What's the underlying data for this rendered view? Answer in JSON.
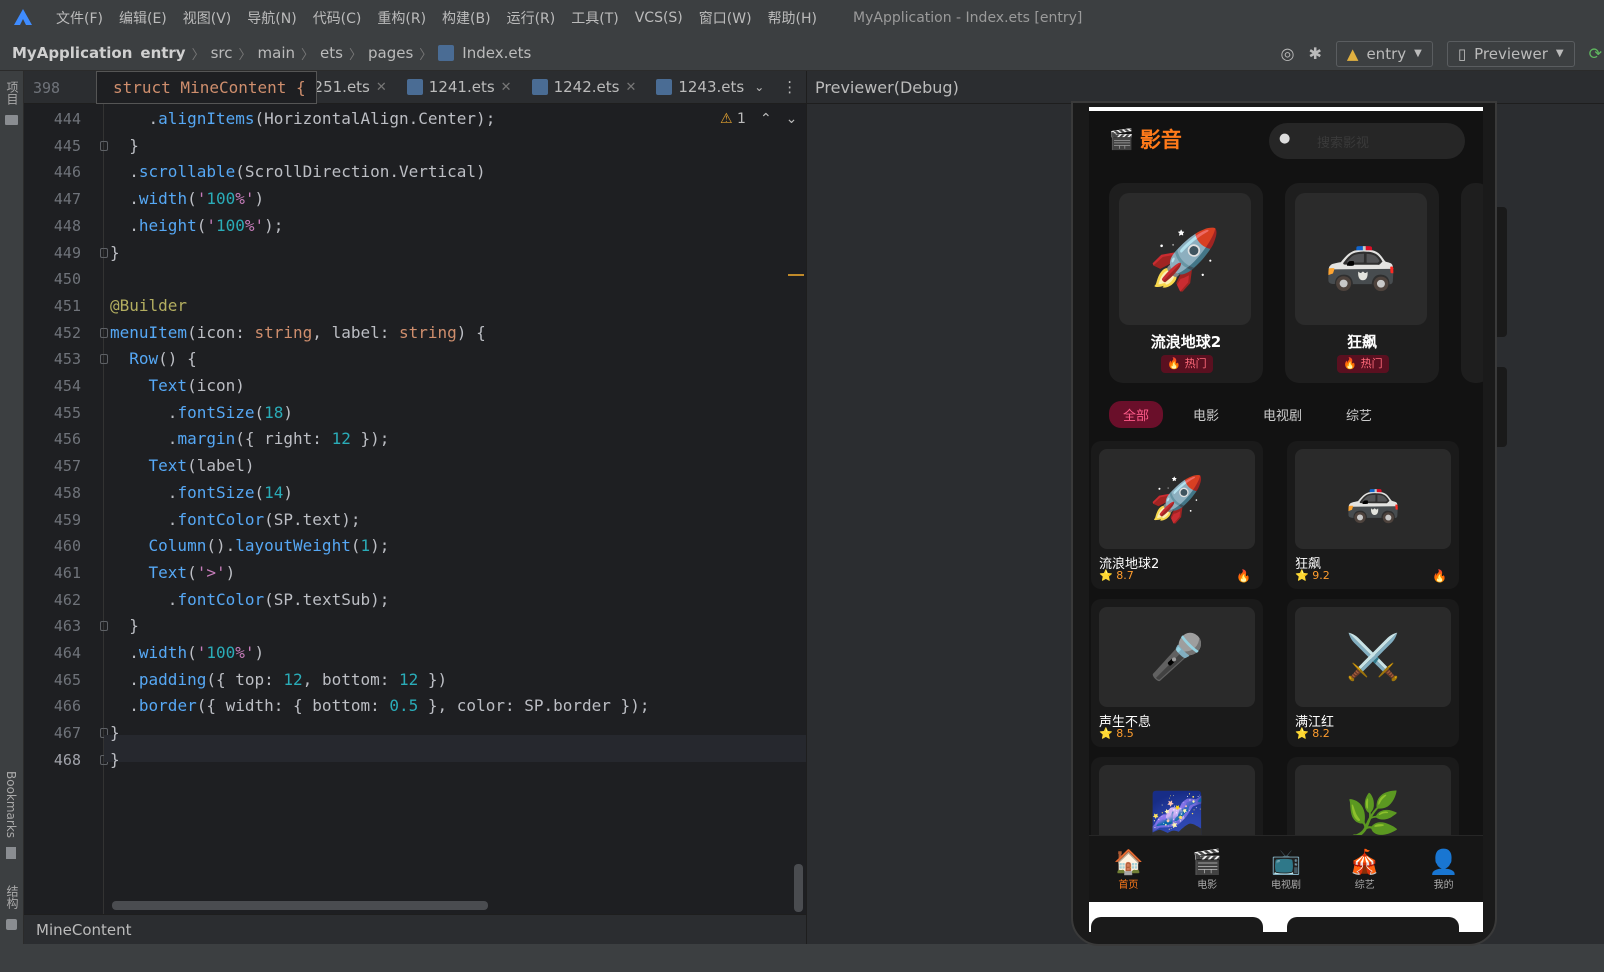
{
  "menubar": {
    "items": [
      "文件(F)",
      "编辑(E)",
      "视图(V)",
      "导航(N)",
      "代码(C)",
      "重构(R)",
      "构建(B)",
      "运行(R)",
      "工具(T)",
      "VCS(S)",
      "窗口(W)",
      "帮助(H)"
    ],
    "window_title": "MyApplication - Index.ets [entry]"
  },
  "breadcrumb": [
    "MyApplication",
    "entry",
    "src",
    "main",
    "ets",
    "pages",
    "Index.ets"
  ],
  "toolbar": {
    "module": "entry",
    "previewer": "Previewer"
  },
  "sidebar": {
    "project": "项目",
    "bookmarks": "Bookmarks",
    "structure": "结构"
  },
  "tabs": [
    "1251.ets",
    "1241.ets",
    "1242.ets",
    "1243.ets"
  ],
  "sticky": {
    "line": "398",
    "code": "struct MineContent {"
  },
  "inspection": {
    "warnings": "1"
  },
  "editor": {
    "lines": [
      {
        "n": "444",
        "t": "    .alignItems(HorizontalAlign.Center);"
      },
      {
        "n": "445",
        "t": "  }"
      },
      {
        "n": "446",
        "t": "  .scrollable(ScrollDirection.Vertical)"
      },
      {
        "n": "447",
        "t": "  .width('100%')"
      },
      {
        "n": "448",
        "t": "  .height('100%');"
      },
      {
        "n": "449",
        "t": "}"
      },
      {
        "n": "450",
        "t": ""
      },
      {
        "n": "451",
        "t": "@Builder"
      },
      {
        "n": "452",
        "t": "menuItem(icon: string, label: string) {"
      },
      {
        "n": "453",
        "t": "  Row() {"
      },
      {
        "n": "454",
        "t": "    Text(icon)"
      },
      {
        "n": "455",
        "t": "      .fontSize(18)"
      },
      {
        "n": "456",
        "t": "      .margin({ right: 12 });"
      },
      {
        "n": "457",
        "t": "    Text(label)"
      },
      {
        "n": "458",
        "t": "      .fontSize(14)"
      },
      {
        "n": "459",
        "t": "      .fontColor(SP.text);"
      },
      {
        "n": "460",
        "t": "    Column().layoutWeight(1);"
      },
      {
        "n": "461",
        "t": "    Text('>')"
      },
      {
        "n": "462",
        "t": "      .fontColor(SP.textSub);"
      },
      {
        "n": "463",
        "t": "  }"
      },
      {
        "n": "464",
        "t": "  .width('100%')"
      },
      {
        "n": "465",
        "t": "  .padding({ top: 12, bottom: 12 })"
      },
      {
        "n": "466",
        "t": "  .border({ width: { bottom: 0.5 }, color: SP.border });"
      },
      {
        "n": "467",
        "t": "}"
      },
      {
        "n": "468",
        "t": "}"
      }
    ]
  },
  "status": {
    "context": "MineContent"
  },
  "preview": {
    "header": "Previewer(Debug)",
    "app_title": "影音",
    "search_placeholder": "搜索影视",
    "featured": [
      {
        "name": "流浪地球2",
        "badge": "🔥 热门",
        "icon": "🚀"
      },
      {
        "name": "狂飙",
        "badge": "🔥 热门",
        "icon": "🚓"
      }
    ],
    "chips": [
      "全部",
      "电影",
      "电视剧",
      "综艺"
    ],
    "grid": [
      {
        "name": "流浪地球2",
        "rating": "⭐ 8.7",
        "icon": "🚀",
        "hot": "🔥"
      },
      {
        "name": "狂飙",
        "rating": "⭐ 9.2",
        "icon": "🚓",
        "hot": "🔥"
      },
      {
        "name": "声生不息",
        "rating": "⭐ 8.5",
        "icon": "🎤",
        "hot": ""
      },
      {
        "name": "满江红",
        "rating": "⭐ 8.2",
        "icon": "⚔️",
        "hot": ""
      },
      {
        "name": "",
        "rating": "",
        "icon": "🌌",
        "hot": ""
      },
      {
        "name": "",
        "rating": "",
        "icon": "🌿",
        "hot": ""
      }
    ],
    "tabbar": [
      {
        "label": "首页",
        "icon": "🏠"
      },
      {
        "label": "电影",
        "icon": "🎬"
      },
      {
        "label": "电视剧",
        "icon": "📺"
      },
      {
        "label": "综艺",
        "icon": "🎪"
      },
      {
        "label": "我的",
        "icon": "👤"
      }
    ]
  }
}
